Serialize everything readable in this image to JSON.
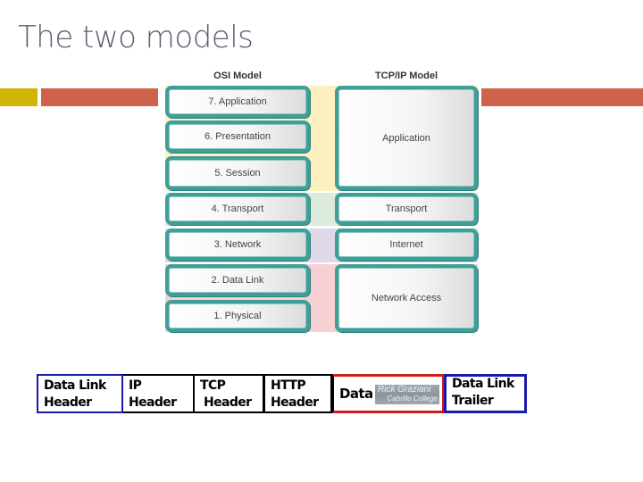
{
  "slide": {
    "title": "The two models",
    "accent_colors": {
      "yellow": "#d1b505",
      "orange": "#cf634a"
    }
  },
  "diagram": {
    "osi": {
      "heading": "OSI Model",
      "layers": [
        "7. Application",
        "6. Presentation",
        "5. Session",
        "4. Transport",
        "3. Network",
        "2. Data Link",
        "1. Physical"
      ]
    },
    "tcpip": {
      "heading": "TCP/IP Model",
      "layers": [
        "Application",
        "Transport",
        "Internet",
        "Network Access"
      ]
    },
    "band_colors": {
      "application": "#fdf1c0",
      "transport": "#dcebdc",
      "internet": "#e1d9ea",
      "network_access": "#f7d0d3"
    },
    "layer_border_color": "#3f9e98"
  },
  "encapsulation": {
    "fields": [
      {
        "line1": "Data Link",
        "line2": "Header",
        "border_color": "#1a1aa8"
      },
      {
        "line1": "IP Header",
        "line2": "",
        "border_color": "#000000"
      },
      {
        "line1": "TCP",
        "line2": "Header",
        "border_color": "#000000"
      },
      {
        "line1": "HTTP",
        "line2": "Header",
        "border_color": "#000000"
      },
      {
        "line1": "Data",
        "line2": "",
        "border_color": "#d11c1c"
      },
      {
        "line1": "Data Link",
        "line2": "Trailer",
        "border_color": "#1a1aa8"
      }
    ],
    "watermark": {
      "line1": "Rick Graziani",
      "line2": "Cabrillo College"
    }
  }
}
